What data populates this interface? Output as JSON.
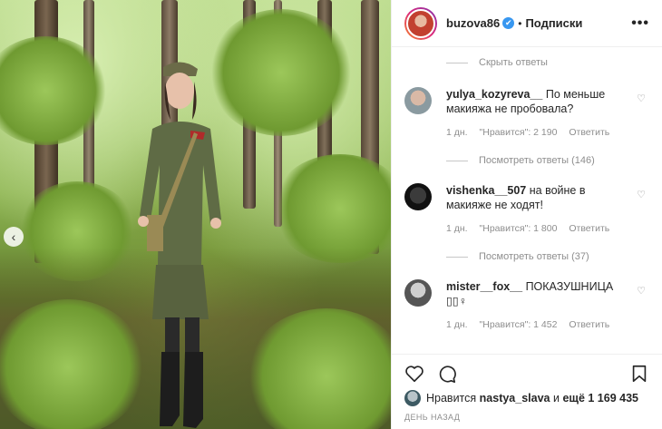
{
  "post": {
    "username": "buzova86",
    "verified_mark": "✔",
    "follow_label": "Подписки",
    "more_label": "•••",
    "slide_prev_symbol": "‹"
  },
  "comments": {
    "hide_replies_label": "Скрыть ответы",
    "items": [
      {
        "username": "yulya_kozyreva__",
        "text": "По меньше макияжа не пробовала?",
        "time": "1 дн.",
        "likes": "\"Нравится\": 2 190",
        "reply_label": "Ответить",
        "view_replies_label": "Посмотреть ответы (146)"
      },
      {
        "username": "vishenka__507",
        "text": "на войне в макияже не ходят!",
        "time": "1 дн.",
        "likes": "\"Нравится\": 1 800",
        "reply_label": "Ответить",
        "view_replies_label": "Посмотреть ответы (37)"
      },
      {
        "username": "mister__fox__",
        "text": "ПОКАЗУШНИЦА ▯▯♀",
        "time": "1 дн.",
        "likes": "\"Нравится\": 1 452",
        "reply_label": "Ответить"
      }
    ]
  },
  "footer": {
    "likes_prefix": "Нравится",
    "likes_user": "nastya_slava",
    "likes_and": "и",
    "likes_rest": "ещё 1 169 435",
    "date": "день назад"
  },
  "icons": [
    "heart-icon",
    "comment-icon",
    "bookmark-icon",
    "verified-icon",
    "more-icon",
    "chevron-left-icon"
  ],
  "colors": {
    "accent": "#3897f0",
    "muted": "#8e8e8e",
    "text": "#262626"
  }
}
